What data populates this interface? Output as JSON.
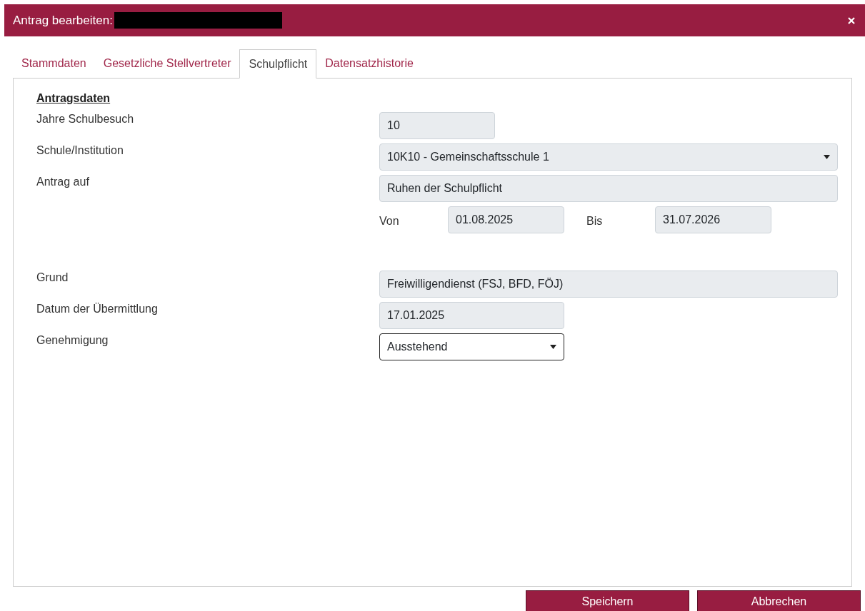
{
  "window": {
    "title": "Antrag bearbeiten:"
  },
  "tabs": [
    {
      "label": "Stammdaten",
      "selected": false
    },
    {
      "label": "Gesetzliche Stellvertreter",
      "selected": false
    },
    {
      "label": "Schulpflicht",
      "selected": true
    },
    {
      "label": "Datensatzhistorie",
      "selected": false
    }
  ],
  "section_title": "Antragsdaten",
  "fields": [
    {
      "kind": "text",
      "label": "Jahre Schulbesuch",
      "value": "10",
      "disabled": true
    },
    {
      "kind": "select",
      "label": "Schule/Institution",
      "value": "10K10 - Gemeinschaftsschule 1",
      "disabled": true
    },
    {
      "kind": "text",
      "label": "Antrag auf",
      "value": "Ruhen der Schulpflicht",
      "disabled": true
    },
    {
      "kind": "range",
      "from_label": "Von",
      "from_value": "01.08.2025",
      "to_label": "Bis",
      "to_value": "31.07.2026",
      "disabled": true
    },
    {
      "kind": "text",
      "label": "Grund",
      "value": "Freiwilligendienst (FSJ, BFD, FÖJ)",
      "disabled": true
    },
    {
      "kind": "text",
      "label": "Datum der Übermittlung",
      "value": "17.01.2025",
      "disabled": true
    },
    {
      "kind": "select",
      "label": "Genehmigung",
      "value": "Ausstehend",
      "disabled": false
    }
  ],
  "buttons": [
    {
      "label": "Speichern"
    },
    {
      "label": "Abbrechen"
    }
  ]
}
